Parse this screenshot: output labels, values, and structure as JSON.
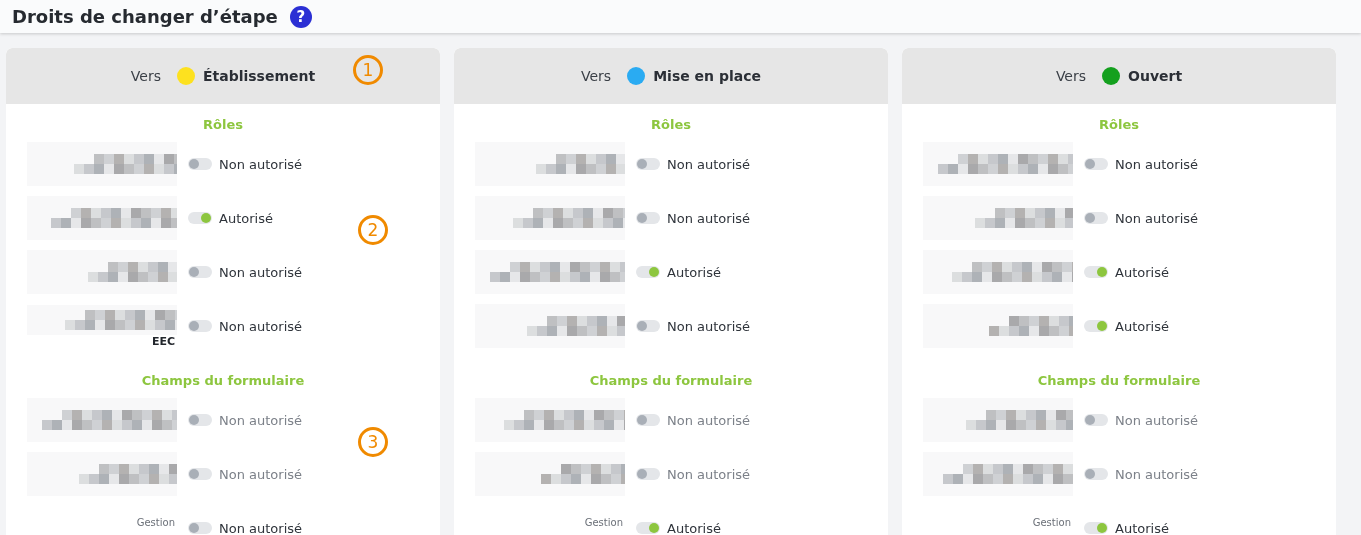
{
  "page_title": "Droits de changer d’étape",
  "help_icon": "?",
  "columns": [
    {
      "prefix": "Vers",
      "stage": "Établissement",
      "color": "#fde11f",
      "sections": [
        {
          "title": "Rôles",
          "rows": [
            {
              "status": "Non autorisé",
              "on": false,
              "disabled": false
            },
            {
              "status": "Autorisé",
              "on": true,
              "disabled": false
            },
            {
              "status": "Non autorisé",
              "on": false,
              "disabled": false
            },
            {
              "status": "Non autorisé",
              "on": false,
              "disabled": false,
              "caption": "EEC"
            }
          ]
        },
        {
          "title": "Champs du formulaire",
          "rows": [
            {
              "status": "Non autorisé",
              "on": false,
              "disabled": true
            },
            {
              "status": "Non autorisé",
              "on": false,
              "disabled": true
            },
            {
              "status": "Non autorisé",
              "on": false,
              "disabled": false,
              "overline": "Gestion"
            }
          ]
        }
      ]
    },
    {
      "prefix": "Vers",
      "stage": "Mise en place",
      "color": "#2aabf2",
      "sections": [
        {
          "title": "Rôles",
          "rows": [
            {
              "status": "Non autorisé",
              "on": false,
              "disabled": false
            },
            {
              "status": "Non autorisé",
              "on": false,
              "disabled": false
            },
            {
              "status": "Autorisé",
              "on": true,
              "disabled": false
            },
            {
              "status": "Non autorisé",
              "on": false,
              "disabled": false
            }
          ]
        },
        {
          "title": "Champs du formulaire",
          "rows": [
            {
              "status": "Non autorisé",
              "on": false,
              "disabled": true
            },
            {
              "status": "Non autorisé",
              "on": false,
              "disabled": true
            },
            {
              "status": "Autorisé",
              "on": true,
              "disabled": false,
              "overline": "Gestion"
            }
          ]
        }
      ]
    },
    {
      "prefix": "Vers",
      "stage": "Ouvert",
      "color": "#14a01e",
      "sections": [
        {
          "title": "Rôles",
          "rows": [
            {
              "status": "Non autorisé",
              "on": false,
              "disabled": false
            },
            {
              "status": "Non autorisé",
              "on": false,
              "disabled": false
            },
            {
              "status": "Autorisé",
              "on": true,
              "disabled": false
            },
            {
              "status": "Autorisé",
              "on": true,
              "disabled": false
            }
          ]
        },
        {
          "title": "Champs du formulaire",
          "rows": [
            {
              "status": "Non autorisé",
              "on": false,
              "disabled": true
            },
            {
              "status": "Non autorisé",
              "on": false,
              "disabled": true
            },
            {
              "status": "Autorisé",
              "on": true,
              "disabled": false,
              "overline": "Gestion"
            }
          ]
        }
      ]
    }
  ],
  "annotations": [
    {
      "label": "1"
    },
    {
      "label": "2"
    },
    {
      "label": "3"
    }
  ]
}
